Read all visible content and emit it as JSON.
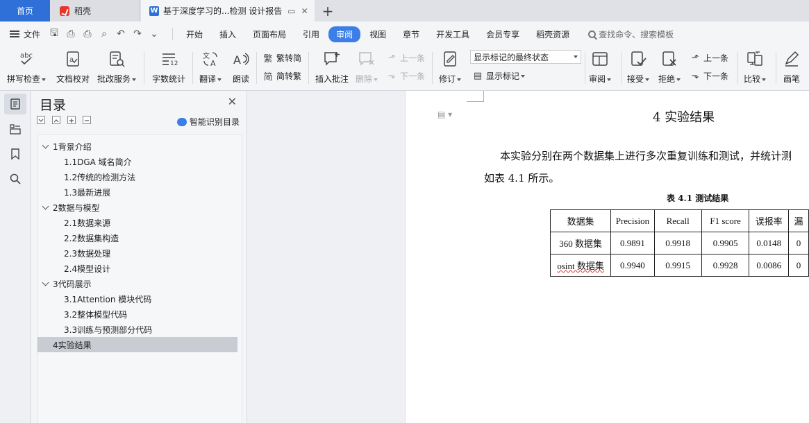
{
  "tabs": {
    "home": "首页",
    "daoke": "稻壳",
    "doc": "基于深度学习的...检测 设计报告",
    "new_tab": "+"
  },
  "menu": {
    "file": "文件",
    "items": [
      "开始",
      "插入",
      "页面布局",
      "引用",
      "审阅",
      "视图",
      "章节",
      "开发工具",
      "会员专享",
      "稻壳资源"
    ],
    "active": "审阅",
    "search": "查找命令、搜索模板"
  },
  "ribbon": {
    "spell": "拼写检查",
    "doc_check": "文档校对",
    "review_service": "批改服务",
    "word_count": "字数统计",
    "translate": "翻译",
    "read_aloud": "朗读",
    "trad_to_simp": "繁转简",
    "simp_to_trad": "简转繁",
    "insert_comment": "插入批注",
    "delete": "删除",
    "prev_comment": "上一条",
    "next_comment": "下一条",
    "track_changes": "修订",
    "markup_state": "显示标记的最终状态",
    "show_markup": "显示标记",
    "review": "审阅",
    "accept": "接受",
    "reject": "拒绝",
    "prev_change": "上一条",
    "next_change": "下一条",
    "compare": "比较",
    "pen": "画笔"
  },
  "toc": {
    "title": "目录",
    "smart": "智能识别目录",
    "items": [
      {
        "label": "1背景介绍",
        "level": 1
      },
      {
        "label": "1.1DGA 域名简介",
        "level": 2
      },
      {
        "label": "1.2传统的检测方法",
        "level": 2
      },
      {
        "label": "1.3最新进展",
        "level": 2
      },
      {
        "label": "2数据与模型",
        "level": 1
      },
      {
        "label": "2.1数据来源",
        "level": 2
      },
      {
        "label": "2.2数据集构造",
        "level": 2
      },
      {
        "label": "2.3数据处理",
        "level": 2
      },
      {
        "label": "2.4模型设计",
        "level": 2
      },
      {
        "label": "3代码展示",
        "level": 1
      },
      {
        "label": "3.1Attention 模块代码",
        "level": 2
      },
      {
        "label": "3.2整体模型代码",
        "level": 2
      },
      {
        "label": "3.3训练与预测部分代码",
        "level": 2
      },
      {
        "label": "4实验结果",
        "level": 1,
        "selected": true
      }
    ]
  },
  "doc": {
    "heading": "4   实验结果",
    "para_line1": "本实验分别在两个数据集上进行多次重复训练和测试，并统计测",
    "para_line2": "如表 4.1 所示。",
    "table_caption": "表 4.1 测试结果",
    "table": {
      "headers": [
        "数据集",
        "Precision",
        "Recall",
        "F1 score",
        "误报率",
        "漏"
      ],
      "rows": [
        [
          "360 数据集",
          "0.9891",
          "0.9918",
          "0.9905",
          "0.0148",
          "0"
        ],
        [
          "osint 数据集",
          "0.9940",
          "0.9915",
          "0.9928",
          "0.0086",
          "0"
        ]
      ]
    }
  },
  "colors": {
    "accent": "#3b7ee8",
    "home_tab": "#2f6fd8",
    "daoke_logo": "#e8352c"
  }
}
